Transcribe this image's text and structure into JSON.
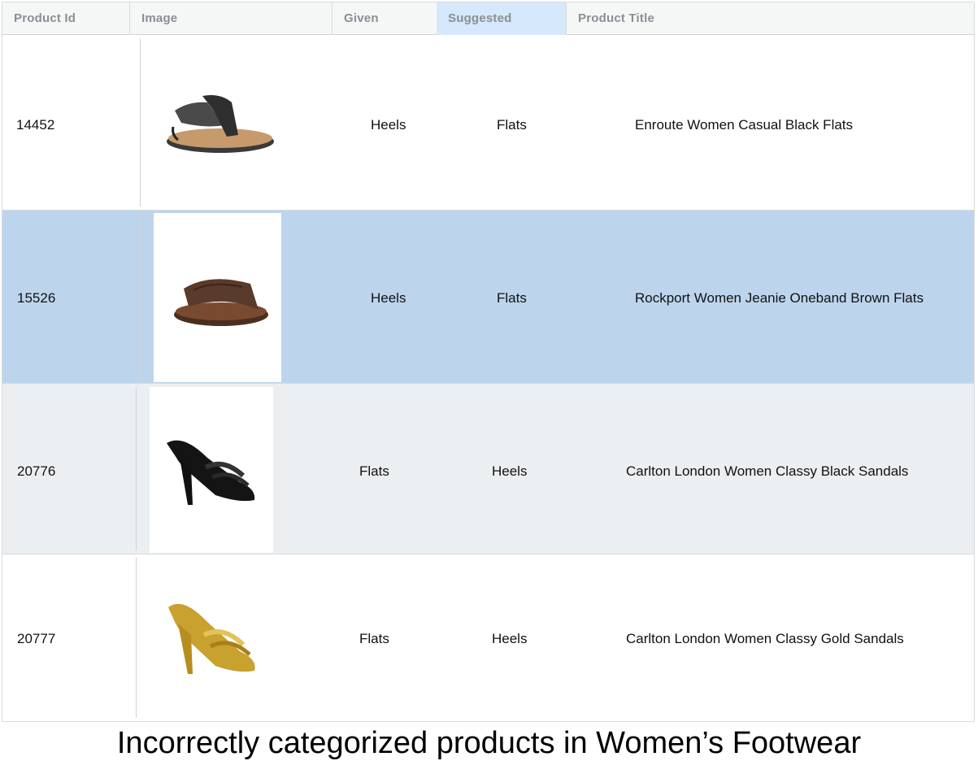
{
  "table": {
    "headers": {
      "product_id": "Product Id",
      "image": "Image",
      "given": "Given",
      "suggested": "Suggested",
      "product_title": "Product Title"
    },
    "rows": [
      {
        "product_id": "14452",
        "image": "black-flat-thong-sandal",
        "given": "Heels",
        "suggested": "Flats",
        "title": "Enroute Women Casual Black Flats"
      },
      {
        "product_id": "15526",
        "image": "brown-oneband-slide",
        "given": "Heels",
        "suggested": "Flats",
        "title": "Rockport Women Jeanie Oneband Brown Flats"
      },
      {
        "product_id": "20776",
        "image": "black-heeled-sandal",
        "given": "Flats",
        "suggested": "Heels",
        "title": "Carlton London Women Classy Black Sandals"
      },
      {
        "product_id": "20777",
        "image": "gold-heeled-sandal",
        "given": "Flats",
        "suggested": "Heels",
        "title": "Carlton London Women Classy Gold Sandals"
      }
    ]
  },
  "colors": {
    "selected_row": "#bdd5ec",
    "alt_row": "#eceff1",
    "active_header": "#d6e8fb"
  },
  "caption": "Incorrectly categorized products in Women’s Footwear"
}
